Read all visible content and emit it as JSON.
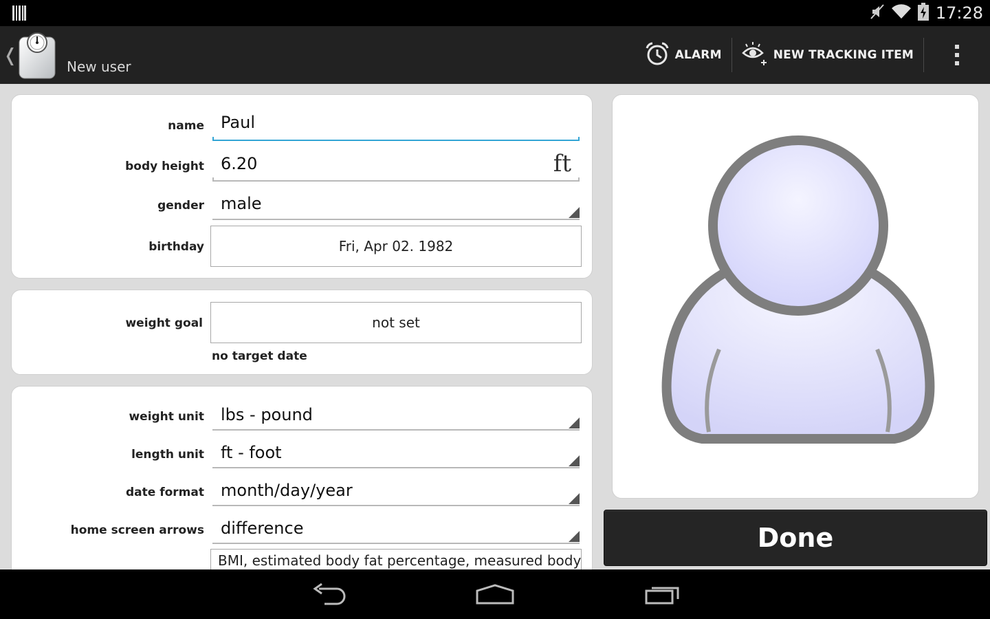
{
  "status_bar": {
    "time": "17:28"
  },
  "action_bar": {
    "app_title": "New user",
    "actions": [
      {
        "label": "ALARM",
        "icon": "alarm-clock-icon"
      },
      {
        "label": "NEW TRACKING ITEM",
        "icon": "eye-plus-icon"
      }
    ]
  },
  "profile": {
    "name": {
      "label": "name",
      "value": "Paul"
    },
    "body_height": {
      "label": "body height",
      "value": "6.20",
      "unit": "ft"
    },
    "gender": {
      "label": "gender",
      "value": "male"
    },
    "birthday": {
      "label": "birthday",
      "value": "Fri, Apr 02. 1982"
    }
  },
  "goal": {
    "weight_goal": {
      "label": "weight goal",
      "value": "not set"
    },
    "target_note": "no target date"
  },
  "settings": {
    "weight_unit": {
      "label": "weight unit",
      "value": "lbs - pound"
    },
    "length_unit": {
      "label": "length unit",
      "value": "ft - foot"
    },
    "date_format": {
      "label": "date format",
      "value": "month/day/year"
    },
    "home_screen_arrows": {
      "label": "home screen arrows",
      "value": "difference"
    },
    "partial_value": "BMI, estimated body fat percentage, measured body fat"
  },
  "done_label": "Done",
  "colors": {
    "accent": "#33a5d5",
    "action_bar": "#222222",
    "background": "#dcdcdc"
  }
}
